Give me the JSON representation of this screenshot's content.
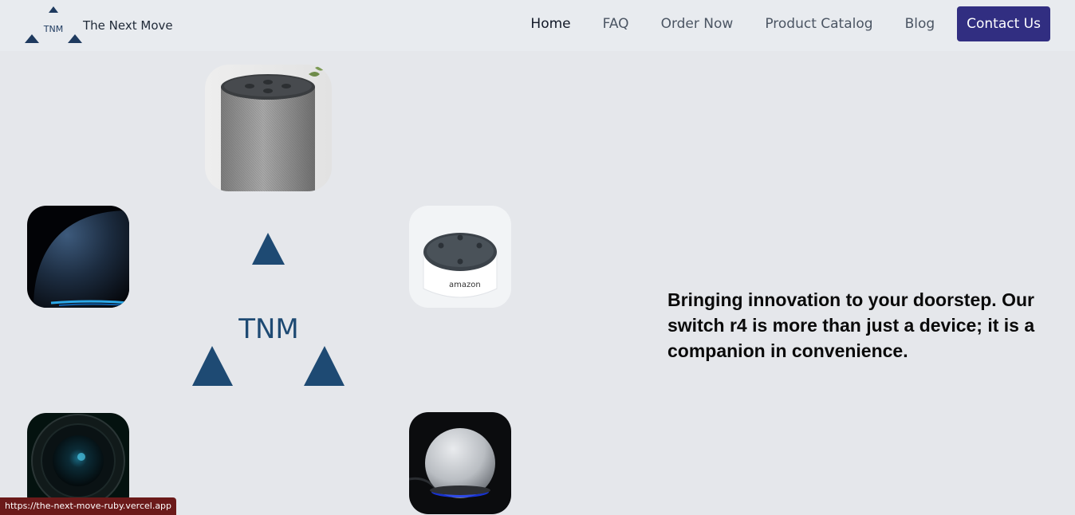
{
  "header": {
    "brand_name": "The Next Move",
    "logo_text": "TNM",
    "nav": [
      "Home",
      "FAQ",
      "Order Now",
      "Product Catalog",
      "Blog"
    ],
    "contact_label": "Contact Us"
  },
  "hero": {
    "logo_text": "TNM",
    "tagline": "Bringing innovation to your doorstep. Our switch r4 is more than just a device; it is a companion in convenience.",
    "images": [
      "speaker-cylinder",
      "speaker-dark-dome",
      "speaker-white-puck",
      "camera-lens",
      "speaker-white-sphere"
    ]
  },
  "status_bar": {
    "url": "https://the-next-move-ruby.vercel.app"
  },
  "colors": {
    "brand_navy": "#1e3a5f",
    "contact_bg": "#312e81",
    "page_bg": "#e5e7eb",
    "header_bg": "#e8ebef"
  }
}
